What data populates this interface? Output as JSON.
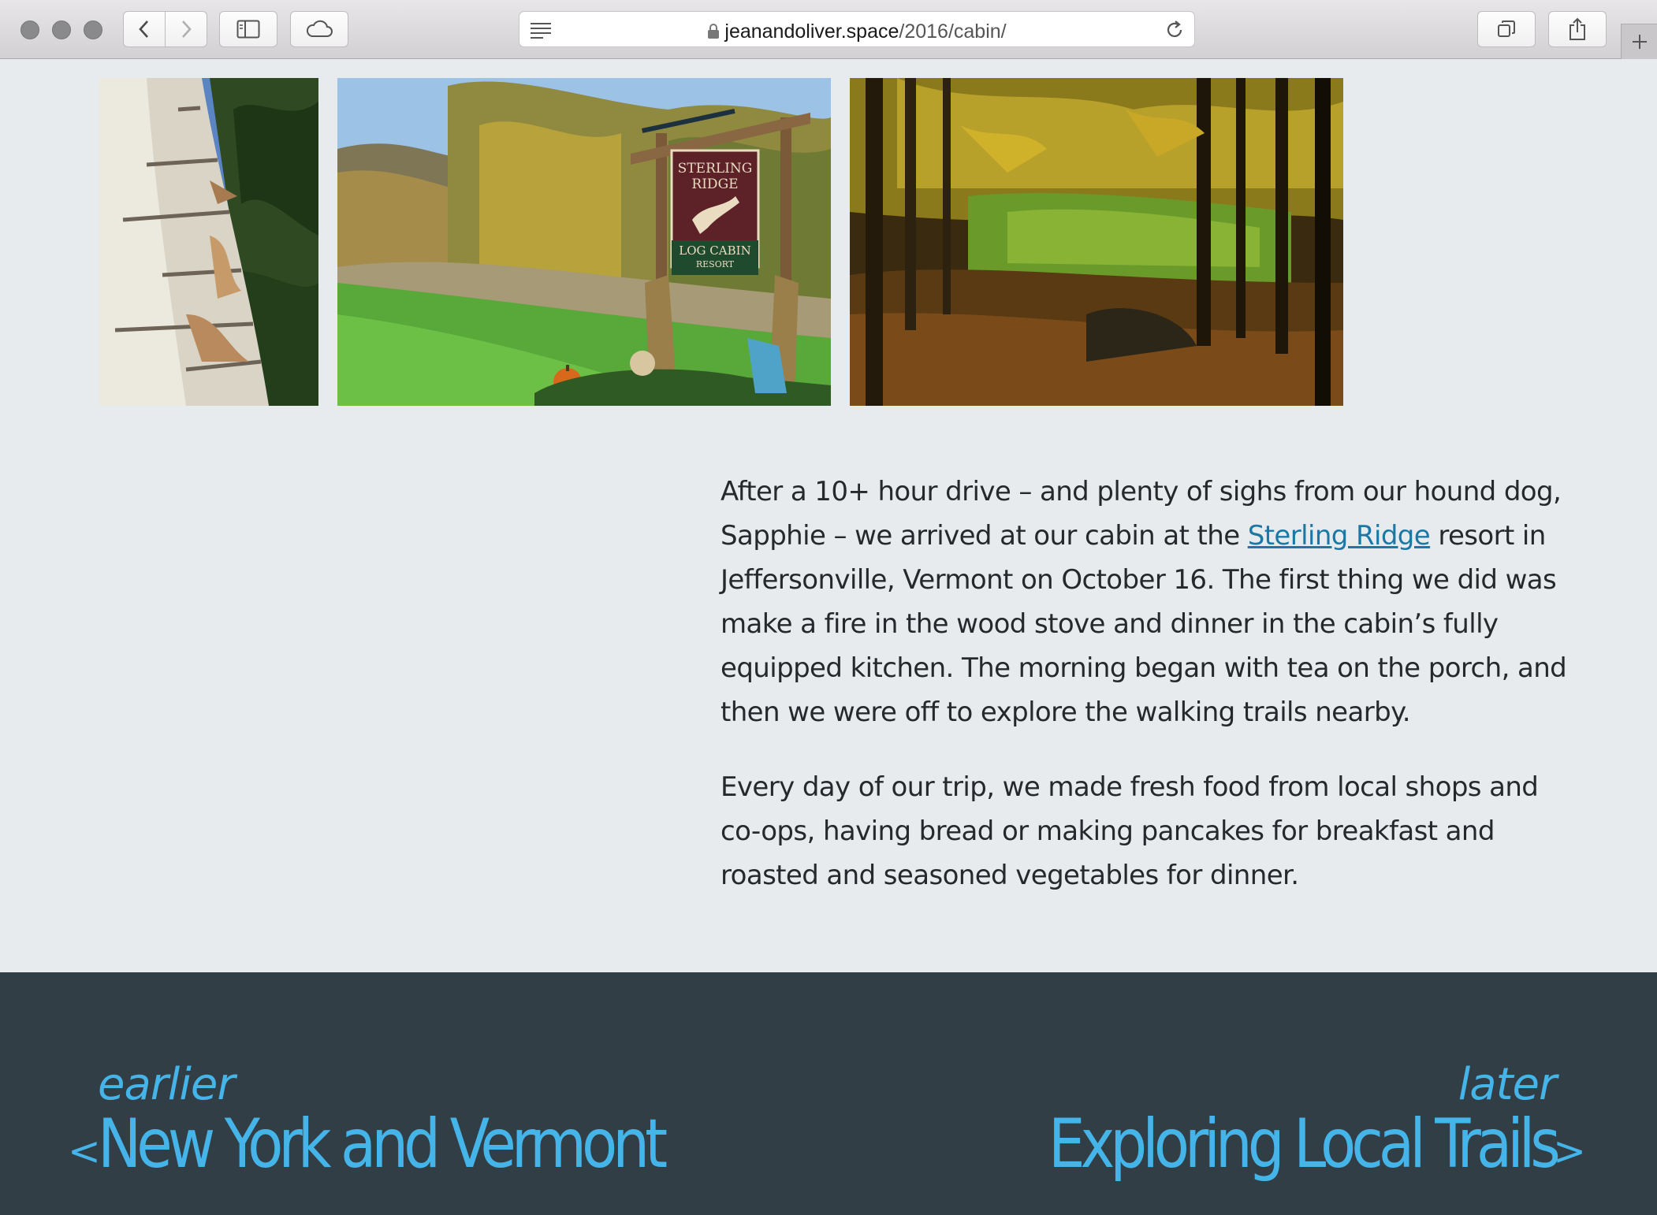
{
  "browser": {
    "url_domain": "jeanandoliver.space",
    "url_path": "/2016/cabin/"
  },
  "photos": [
    {
      "name": "birch-tree-bark"
    },
    {
      "name": "sterling-ridge-sign",
      "sign_line1": "STERLING",
      "sign_line2": "RIDGE",
      "sign_line3": "LOG CABIN",
      "sign_line4": "RESORT"
    },
    {
      "name": "autumn-forest-meadow"
    }
  ],
  "article": {
    "p1_before": "After a 10+ hour drive – and plenty of sighs from our hound dog, Sapphie – we arrived at our cabin at the ",
    "p1_link": "Sterling Ridge",
    "p1_after": " resort in Jeffersonville, Vermont on October 16. The first thing we did was make a fire in the wood stove and dinner in the cabin’s fully equipped kitchen. The morning began with tea on the porch, and then we were off to explore the walking trails nearby.",
    "p2": "Every day of our trip, we made fresh food from local shops and co-ops, having bread or making pancakes for breakfast and roasted and seasoned vegetables for dinner."
  },
  "footer": {
    "earlier_label": "earlier",
    "earlier_title": "New York and Vermont",
    "earlier_chevron": "<",
    "later_label": "later",
    "later_title": "Exploring Local Trails",
    "later_chevron": ">"
  },
  "colors": {
    "page_bg": "#e8ebee",
    "footer_bg": "#323e46",
    "accent": "#45b4e8",
    "link": "#1b78a4"
  }
}
